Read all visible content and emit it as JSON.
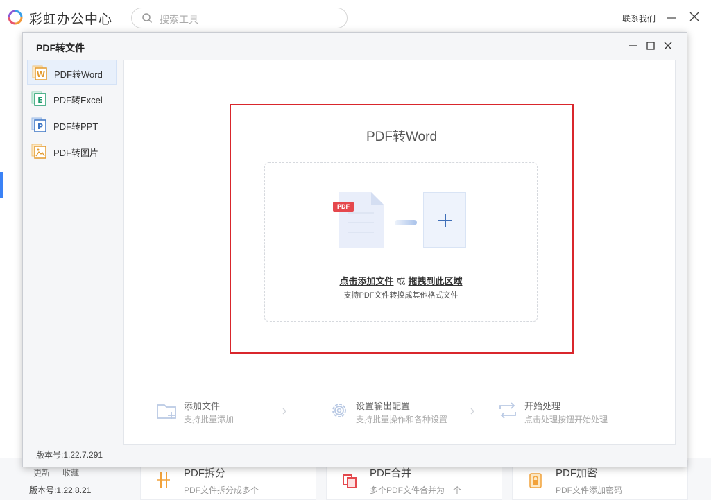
{
  "app": {
    "title": "彩虹办公中心",
    "search_placeholder": "搜索工具",
    "contact_label": "联系我们"
  },
  "background": {
    "update_label": "更新",
    "favorite_label": "收藏",
    "version": "版本号:1.22.8.21",
    "cards": [
      {
        "title": "PDF拆分",
        "desc": "PDF文件拆分成多个"
      },
      {
        "title": "PDF合并",
        "desc": "多个PDF文件合并为一个"
      },
      {
        "title": "PDF加密",
        "desc": "PDF文件添加密码"
      }
    ]
  },
  "dialog": {
    "title": "PDF转文件",
    "version": "版本号:1.22.7.291",
    "sidebar": [
      {
        "label": "PDF转Word",
        "icon_letter": "W",
        "color": "#e39a2d",
        "active": true
      },
      {
        "label": "PDF转Excel",
        "icon_letter": "E",
        "color": "#1f9c6b",
        "active": false
      },
      {
        "label": "PDF转PPT",
        "icon_letter": "P",
        "color": "#3b74c4",
        "active": false
      },
      {
        "label": "PDF转图片",
        "icon_letter": "",
        "color": "#e39a2d",
        "active": false
      }
    ],
    "main": {
      "title": "PDF转Word",
      "pdf_badge": "PDF",
      "add_file_link": "点击添加文件",
      "or_text": "或",
      "drag_link": "拖拽到此区域",
      "support_text": "支持PDF文件转换成其他格式文件"
    },
    "steps": [
      {
        "title": "添加文件",
        "desc": "支持批量添加"
      },
      {
        "title": "设置输出配置",
        "desc": "支持批量操作和各种设置"
      },
      {
        "title": "开始处理",
        "desc": "点击处理按钮开始处理"
      }
    ]
  },
  "colors": {
    "accent": "#3b82f6",
    "highlight_border": "#d9262c",
    "pdf_red": "#e5484d"
  }
}
